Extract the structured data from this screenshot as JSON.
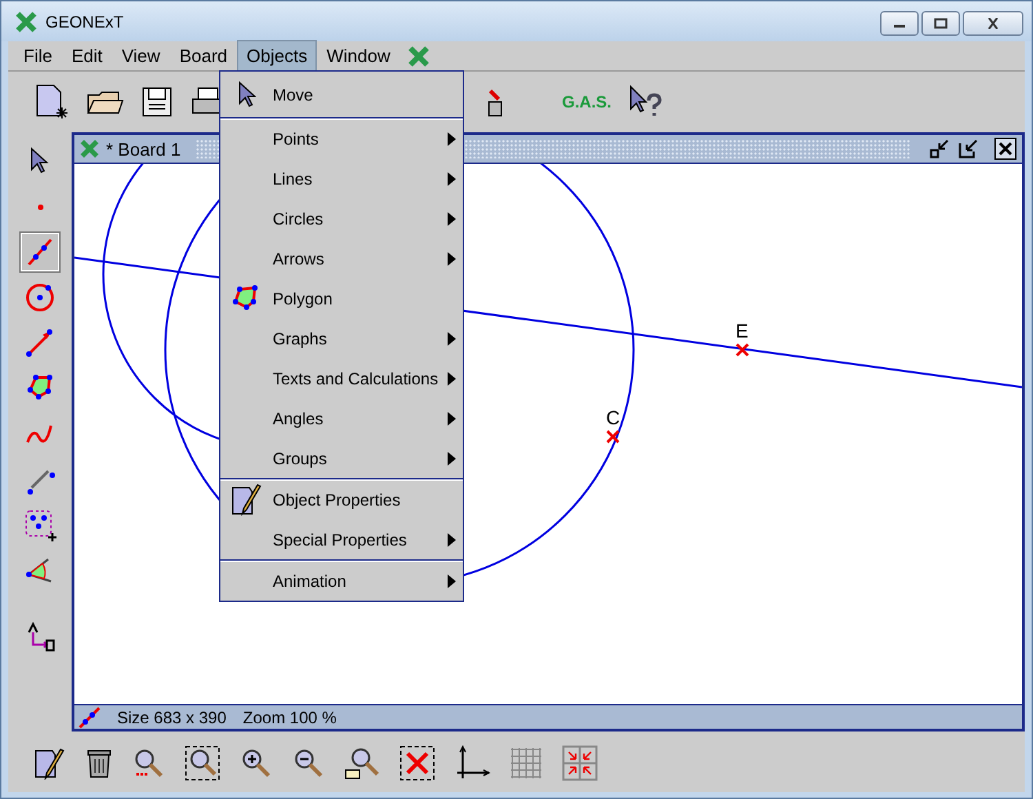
{
  "window": {
    "title": "GEONExT"
  },
  "menu_bar": [
    {
      "label": "File",
      "selected": false
    },
    {
      "label": "Edit",
      "selected": false
    },
    {
      "label": "View",
      "selected": false
    },
    {
      "label": "Board",
      "selected": false
    },
    {
      "label": "Objects",
      "selected": true
    },
    {
      "label": "Window",
      "selected": false
    }
  ],
  "toolbar": {
    "gas_label": "G.A.S."
  },
  "objects_menu": [
    [
      {
        "label": "Move",
        "kind": "cursor",
        "submenu": false
      }
    ],
    [
      {
        "label": "Points",
        "kind": "plain",
        "submenu": true
      },
      {
        "label": "Lines",
        "kind": "plain",
        "submenu": true
      },
      {
        "label": "Circles",
        "kind": "plain",
        "submenu": true
      },
      {
        "label": "Arrows",
        "kind": "plain",
        "submenu": true
      },
      {
        "label": "Polygon",
        "kind": "polygon",
        "submenu": false
      },
      {
        "label": "Graphs",
        "kind": "plain",
        "submenu": true
      },
      {
        "label": "Texts and Calculations",
        "kind": "plain",
        "submenu": true
      },
      {
        "label": "Angles",
        "kind": "plain",
        "submenu": true
      },
      {
        "label": "Groups",
        "kind": "plain",
        "submenu": true
      }
    ],
    [
      {
        "label": "Object Properties",
        "kind": "properties",
        "submenu": false
      },
      {
        "label": "Special Properties",
        "kind": "plain",
        "submenu": true
      }
    ],
    [
      {
        "label": "Animation",
        "kind": "plain",
        "submenu": true
      }
    ]
  ],
  "left_tools": [
    {
      "kind": "pointer",
      "selected": false
    },
    {
      "kind": "point",
      "selected": false
    },
    {
      "kind": "line",
      "selected": true
    },
    {
      "kind": "circle",
      "selected": false
    },
    {
      "kind": "arrow",
      "selected": false
    },
    {
      "kind": "polygon",
      "selected": false
    },
    {
      "kind": "graph",
      "selected": false
    },
    {
      "kind": "measure",
      "selected": false
    },
    {
      "kind": "group",
      "selected": false
    },
    {
      "kind": "angle",
      "selected": false
    },
    {
      "kind": "text",
      "selected": false
    }
  ],
  "board": {
    "title": "* Board 1",
    "points": [
      {
        "label": "E"
      },
      {
        "label": "C"
      }
    ],
    "status": {
      "size": "Size 683 x 390",
      "zoom": "Zoom 100 %"
    }
  }
}
